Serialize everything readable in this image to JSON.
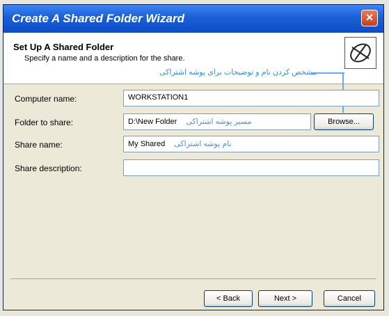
{
  "window": {
    "title": "Create A Shared Folder Wizard",
    "close_label": "×"
  },
  "header": {
    "title": "Set Up A Shared Folder",
    "subtitle": "Specify a name and a description for the share.",
    "annotation": "مشخص کردن نام و توضیحات برای پوشه اشتراکی"
  },
  "form": {
    "computer_name": {
      "label": "Computer name:",
      "value": "WORKSTATION1"
    },
    "folder_to_share": {
      "label": "Folder to share:",
      "value": "D:\\New Folder",
      "note": "مسیر پوشه اشتراکی"
    },
    "share_name": {
      "label": "Share name:",
      "value": "My Shared",
      "note": "نام پوشه اشتراکی"
    },
    "share_description": {
      "label": "Share description:",
      "value": ""
    },
    "browse_label": "Browse..."
  },
  "footer": {
    "back_label": "< Back",
    "next_label": "Next >",
    "cancel_label": "Cancel"
  },
  "colors": {
    "titlebar": "#1a5fd6",
    "annotation": "#2f8fe0"
  }
}
